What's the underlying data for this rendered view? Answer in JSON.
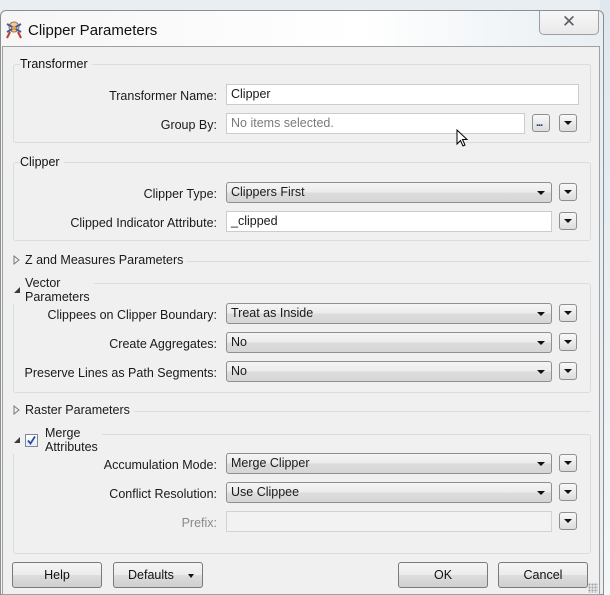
{
  "window": {
    "title": "Clipper Parameters",
    "close_glyph": "✕"
  },
  "transformer_group": {
    "title": "Transformer",
    "name_label": "Transformer Name:",
    "name_value": "Clipper",
    "group_by_label": "Group By:",
    "group_by_placeholder": "No items selected.",
    "ellipsis_label": "..."
  },
  "clipper_group": {
    "title": "Clipper",
    "clipper_type_label": "Clipper Type:",
    "clipper_type_value": "Clippers First",
    "clipped_indicator_label": "Clipped Indicator Attribute:",
    "clipped_indicator_value": "_clipped"
  },
  "z_measures": {
    "title": "Z and Measures Parameters",
    "expanded": false
  },
  "vector_group": {
    "title": "Vector Parameters",
    "expanded": true,
    "boundary_label": "Clippees on Clipper Boundary:",
    "boundary_value": "Treat as Inside",
    "aggregates_label": "Create Aggregates:",
    "aggregates_value": "No",
    "preserve_lines_label": "Preserve Lines as Path Segments:",
    "preserve_lines_value": "No"
  },
  "raster": {
    "title": "Raster Parameters",
    "expanded": false
  },
  "merge_group": {
    "title": "Merge Attributes",
    "checked": true,
    "expanded": true,
    "accumulation_label": "Accumulation Mode:",
    "accumulation_value": "Merge Clipper",
    "conflict_label": "Conflict Resolution:",
    "conflict_value": "Use Clippee",
    "prefix_label": "Prefix:",
    "prefix_value": ""
  },
  "footer": {
    "help_label": "Help",
    "defaults_label": "Defaults",
    "ok_label": "OK",
    "cancel_label": "Cancel"
  }
}
